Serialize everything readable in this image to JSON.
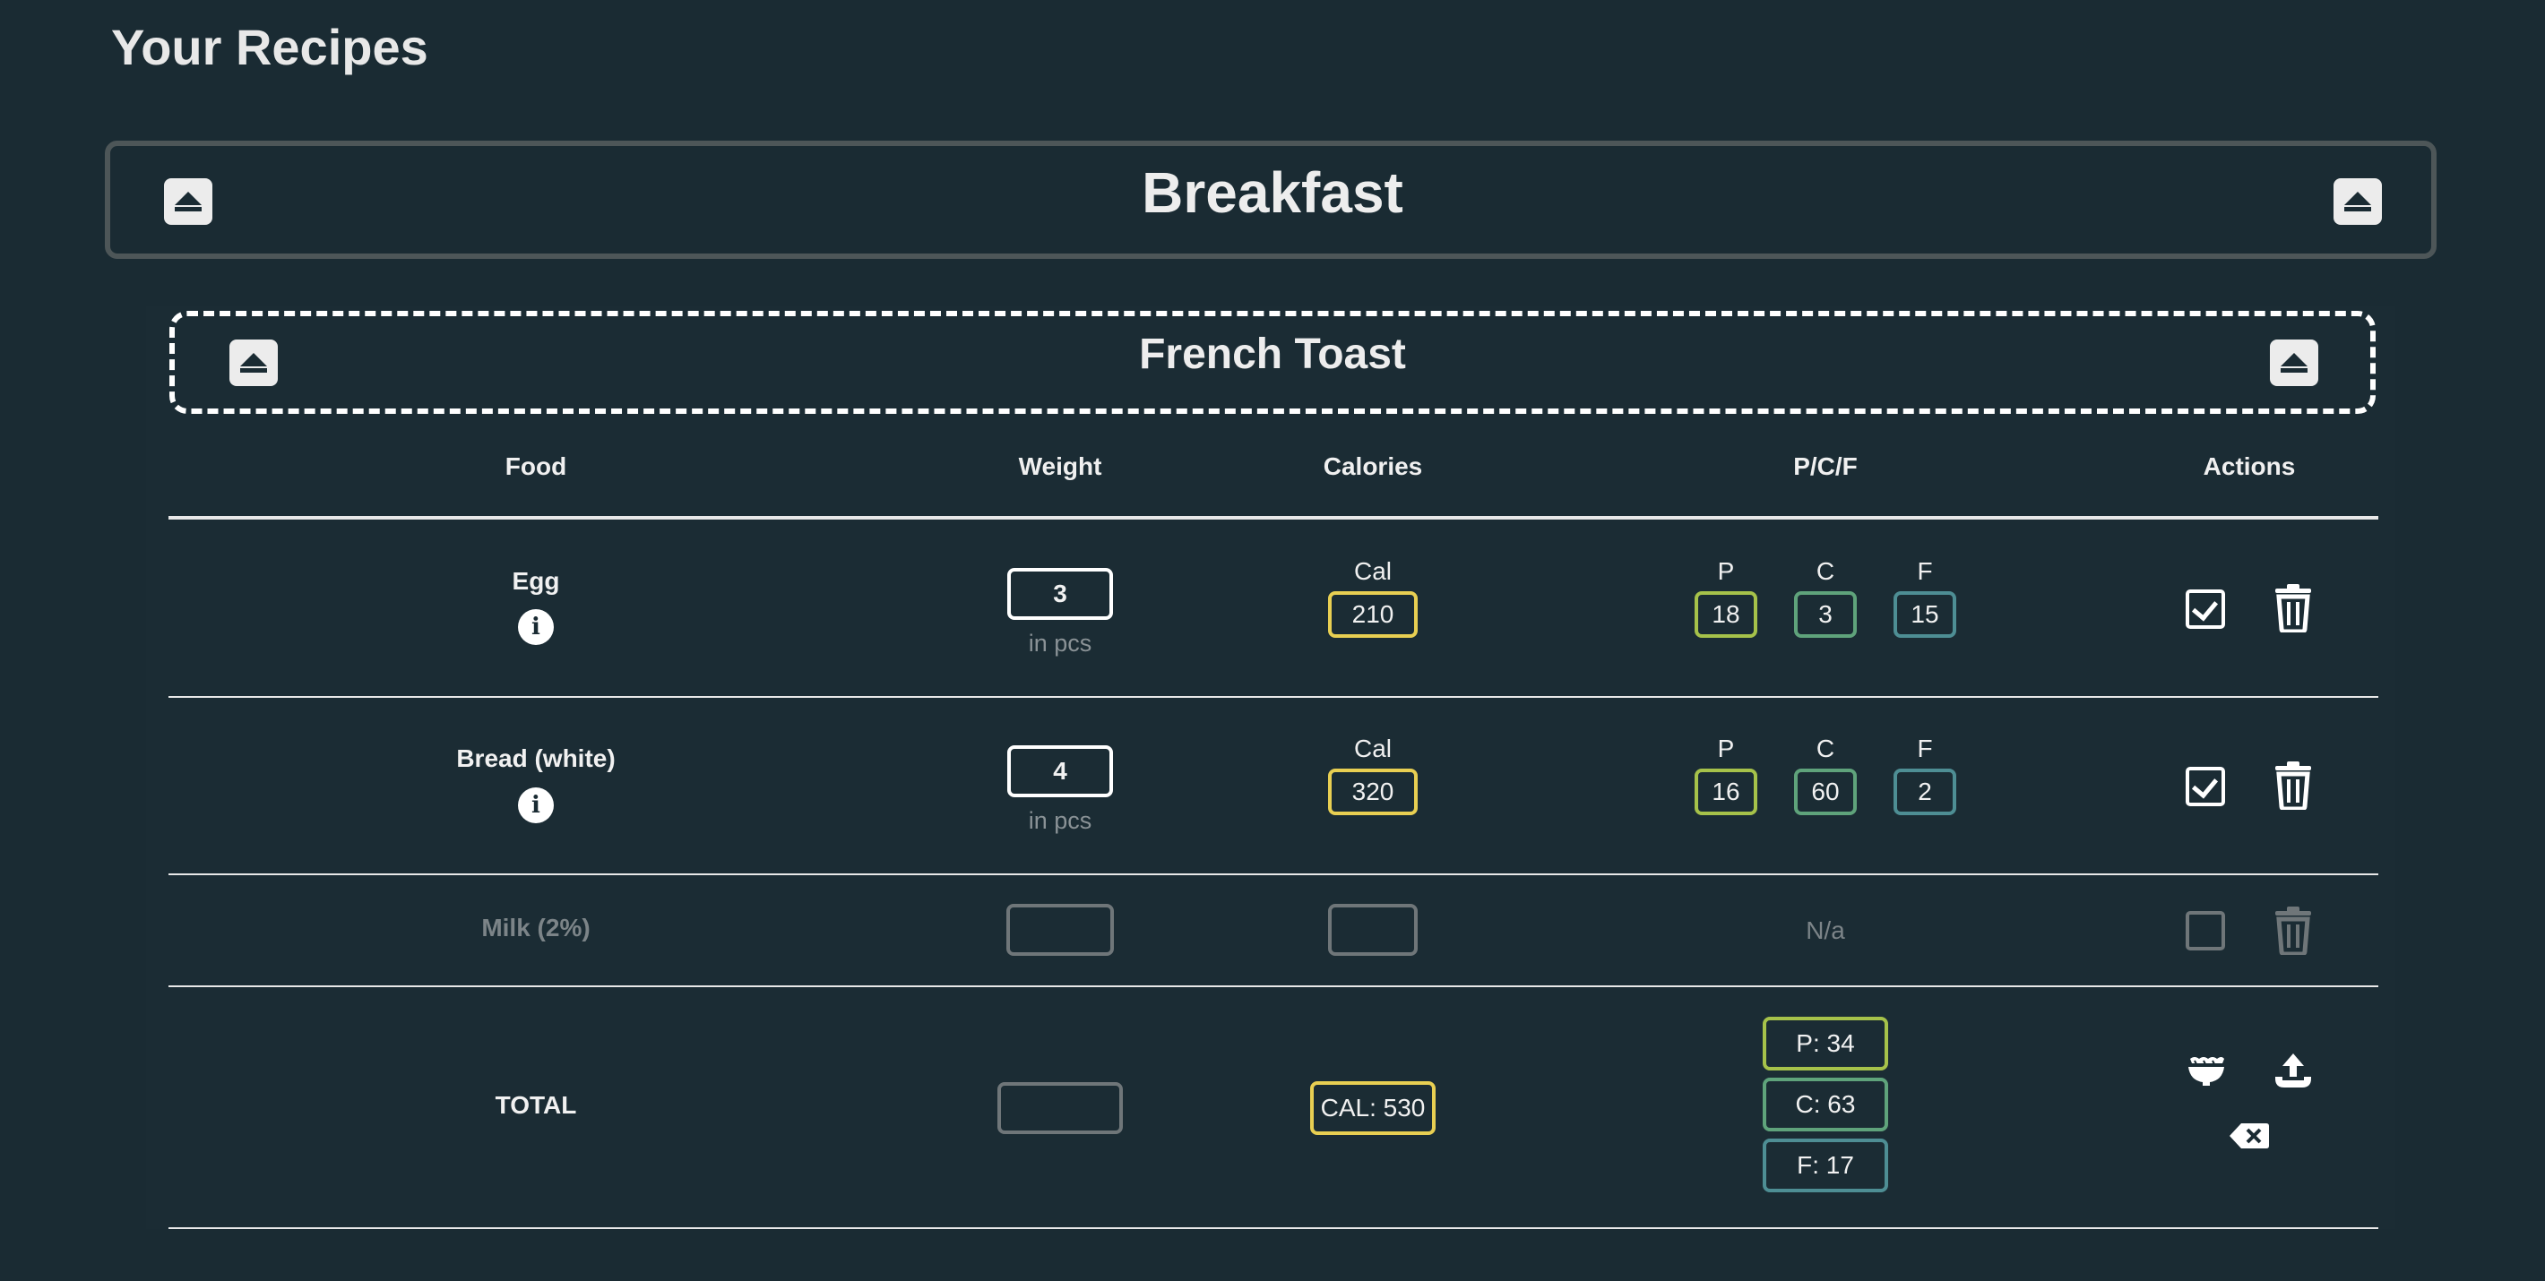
{
  "page": {
    "title": "Your Recipes"
  },
  "meal": {
    "title": "Breakfast"
  },
  "recipe": {
    "title": "French Toast"
  },
  "table": {
    "headers": {
      "food": "Food",
      "weight": "Weight",
      "calories": "Calories",
      "pcf": "P/C/F",
      "actions": "Actions"
    },
    "rows": [
      {
        "food": "Egg",
        "weight": "3",
        "unit": "in pcs",
        "cal_label": "Cal",
        "cal": "210",
        "p_label": "P",
        "c_label": "C",
        "f_label": "F",
        "p": "18",
        "c": "3",
        "f": "15",
        "checked": true
      },
      {
        "food": "Bread (white)",
        "weight": "4",
        "unit": "in pcs",
        "cal_label": "Cal",
        "cal": "320",
        "p_label": "P",
        "c_label": "C",
        "f_label": "F",
        "p": "16",
        "c": "60",
        "f": "2",
        "checked": true
      },
      {
        "food": "Milk (2%)",
        "pcf": "N/a",
        "checked": false
      }
    ],
    "total": {
      "label": "TOTAL",
      "cal": "CAL: 530",
      "p": "P: 34",
      "c": "C: 63",
      "f": "F: 17"
    }
  },
  "colors": {
    "background": "#1a2b33",
    "calories": "#e8cf52",
    "protein": "#a6c24a",
    "carbs": "#5fa37b",
    "fat": "#4e8e94"
  },
  "icons": {
    "meal_toggles": [
      "caret-up-icon",
      "caret-up-icon"
    ],
    "recipe_toggles": [
      "caret-up-icon",
      "caret-up-icon"
    ],
    "info": "info-icon",
    "row_actions": [
      "checkbox-icon",
      "trash-icon"
    ],
    "total_actions": [
      "bowl-icon",
      "upload-icon",
      "backspace-icon"
    ]
  }
}
